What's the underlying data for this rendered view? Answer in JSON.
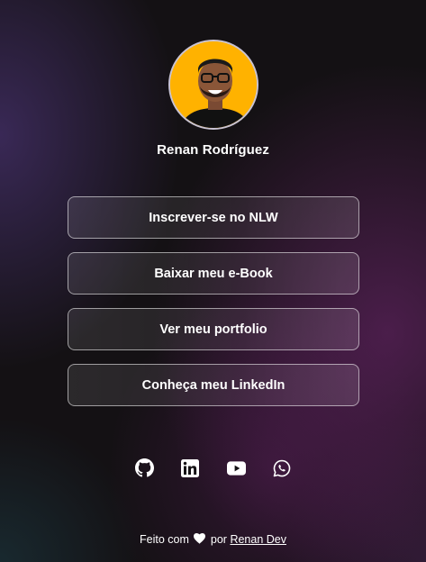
{
  "profile": {
    "name": "Renan Rodríguez",
    "avatar_bg": "#ffb200"
  },
  "links": [
    {
      "label": "Inscrever-se no NLW"
    },
    {
      "label": "Baixar meu e-Book"
    },
    {
      "label": "Ver meu portfolio"
    },
    {
      "label": "Conheça meu LinkedIn"
    }
  ],
  "social": [
    {
      "icon": "github-icon"
    },
    {
      "icon": "linkedin-icon"
    },
    {
      "icon": "youtube-icon"
    },
    {
      "icon": "whatsapp-icon"
    }
  ],
  "footer": {
    "prefix": "Feito com",
    "heart_icon": "heart-icon",
    "by": "por",
    "author_link": "Renan Dev"
  },
  "colors": {
    "background": "#141114",
    "accent_purple": "#7a2a7a",
    "text": "#ffffff"
  }
}
